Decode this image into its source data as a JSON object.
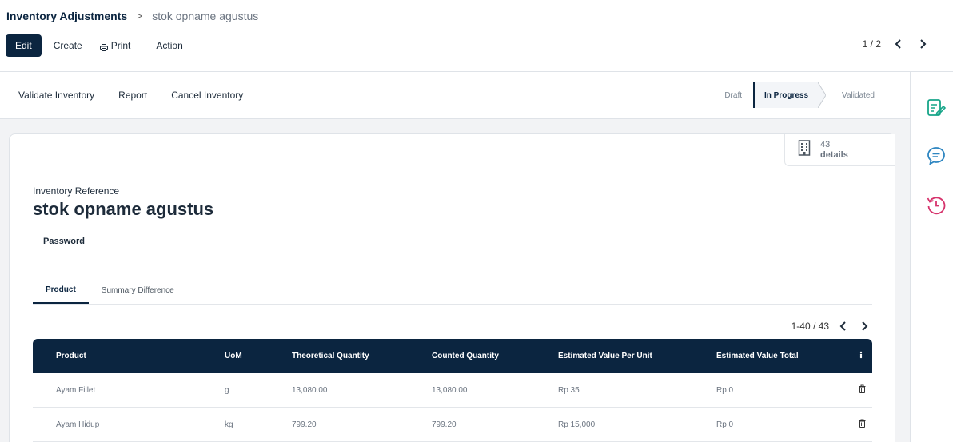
{
  "breadcrumb": {
    "root": "Inventory Adjustments",
    "separator": ">",
    "current": "stok opname agustus"
  },
  "toolbar": {
    "edit": "Edit",
    "create": "Create",
    "print": "Print",
    "action": "Action"
  },
  "record_pager": {
    "text": "1 / 2"
  },
  "status_actions": {
    "validate": "Validate Inventory",
    "report": "Report",
    "cancel": "Cancel Inventory"
  },
  "stages": [
    {
      "label": "Draft",
      "active": false
    },
    {
      "label": "In Progress",
      "active": true
    },
    {
      "label": "Validated",
      "active": false
    }
  ],
  "smart_button": {
    "count": "43",
    "label": "details"
  },
  "form": {
    "reference_label": "Inventory Reference",
    "reference_value": "stok opname agustus",
    "password_label": "Password"
  },
  "tabs": {
    "product": "Product",
    "summary": "Summary Difference"
  },
  "table_pager": {
    "text": "1-40 / 43"
  },
  "table": {
    "columns": [
      "Product",
      "UoM",
      "Theoretical Quantity",
      "Counted Quantity",
      "Estimated Value Per Unit",
      "Estimated Value Total"
    ],
    "rows": [
      {
        "product": "Ayam Fillet",
        "uom": "g",
        "theoretical": "13,080.00",
        "counted": "13,080.00",
        "per_unit": "Rp 35",
        "total": "Rp 0"
      },
      {
        "product": "Ayam Hidup",
        "uom": "kg",
        "theoretical": "799.20",
        "counted": "799.20",
        "per_unit": "Rp 15,000",
        "total": "Rp 0"
      }
    ]
  },
  "colors": {
    "primary": "#0b2540",
    "accent_teal": "#17a589",
    "accent_blue": "#2e86c1",
    "accent_pink": "#d6336c"
  },
  "icons": [
    "print-icon",
    "chevron-left-icon",
    "chevron-right-icon",
    "building-icon",
    "column-options-icon",
    "trash-icon",
    "note-edit-icon",
    "chat-icon",
    "history-icon"
  ]
}
